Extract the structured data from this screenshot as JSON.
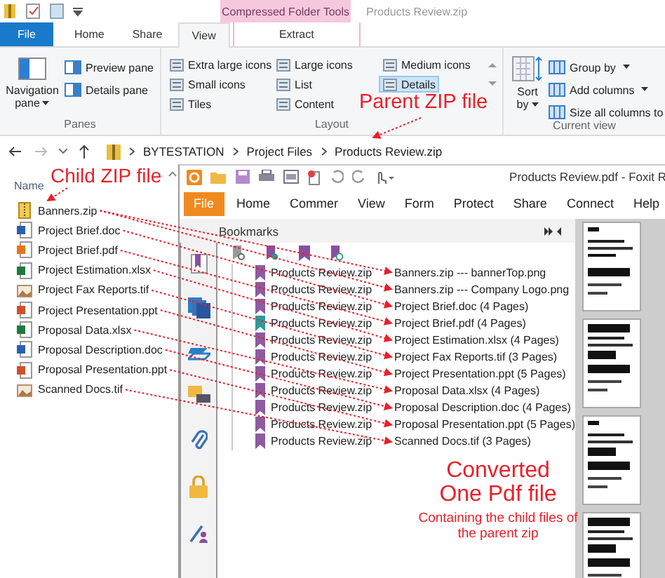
{
  "explorer": {
    "context_tab": "Compressed Folder Tools",
    "title": "Products Review.zip",
    "tabs": [
      {
        "label": "File",
        "kind": "file",
        "selected": false
      },
      {
        "label": "Home",
        "kind": "tab",
        "selected": false
      },
      {
        "label": "Share",
        "kind": "tab",
        "selected": false
      },
      {
        "label": "View",
        "kind": "tab",
        "selected": true
      },
      {
        "label": "Extract",
        "kind": "context",
        "selected": false
      }
    ],
    "ribbon": {
      "panes": {
        "label": "Panes",
        "navigation": {
          "label": "Navigation pane",
          "dropdown": true
        },
        "items": [
          "Preview pane",
          "Details pane"
        ]
      },
      "layout": {
        "label": "Layout",
        "options": [
          {
            "label": "Extra large icons",
            "selected": false
          },
          {
            "label": "Large icons",
            "selected": false
          },
          {
            "label": "Medium icons",
            "selected": false
          },
          {
            "label": "Small icons",
            "selected": false
          },
          {
            "label": "List",
            "selected": false
          },
          {
            "label": "Details",
            "selected": true
          },
          {
            "label": "Tiles",
            "selected": false
          },
          {
            "label": "Content",
            "selected": false
          }
        ]
      },
      "current_view": {
        "label": "Current view",
        "sort": {
          "label": "Sort by",
          "dropdown": true
        },
        "items": [
          {
            "label": "Group by",
            "dropdown": true
          },
          {
            "label": "Add columns",
            "dropdown": true
          },
          {
            "label": "Size all columns to",
            "dropdown": false
          }
        ]
      }
    },
    "address_bar": {
      "path": [
        "BYTESTATION",
        "Project Files",
        "Products Review.zip"
      ]
    },
    "file_list": {
      "header": "Name",
      "files": [
        {
          "name": "Banners.zip",
          "kind": "zip"
        },
        {
          "name": "Project Brief.doc",
          "kind": "doc"
        },
        {
          "name": "Project Brief.pdf",
          "kind": "pdf"
        },
        {
          "name": "Project Estimation.xlsx",
          "kind": "xlsx"
        },
        {
          "name": "Project Fax Reports.tif",
          "kind": "tif"
        },
        {
          "name": "Project Presentation.ppt",
          "kind": "ppt"
        },
        {
          "name": "Proposal Data.xlsx",
          "kind": "xlsx"
        },
        {
          "name": "Proposal Description.doc",
          "kind": "doc"
        },
        {
          "name": "Proposal Presentation.ppt",
          "kind": "ppt"
        },
        {
          "name": "Scanned Docs.tif",
          "kind": "tif"
        }
      ]
    }
  },
  "pdf_viewer": {
    "title": "Products Review.pdf - Foxit R",
    "menu": [
      {
        "label": "File",
        "selected": true
      },
      {
        "label": "Home",
        "selected": false
      },
      {
        "label": "Commer",
        "selected": false
      },
      {
        "label": "View",
        "selected": false
      },
      {
        "label": "Form",
        "selected": false
      },
      {
        "label": "Protect",
        "selected": false
      },
      {
        "label": "Share",
        "selected": false
      },
      {
        "label": "Connect",
        "selected": false
      },
      {
        "label": "Help",
        "selected": false
      }
    ],
    "panel_title": "Bookmarks",
    "bookmarks": [
      {
        "prefix": "Products Review.zip",
        "entry": "Banners.zip --- bannerTop.png",
        "color": "#8e5aa0"
      },
      {
        "prefix": "Products Review.zip",
        "entry": "Banners.zip --- Company Logo.png",
        "color": "#8e5aa0"
      },
      {
        "prefix": "Products Review.zip",
        "entry": "Project Brief.doc (4 Pages)",
        "color": "#8e5aa0"
      },
      {
        "prefix": "Products Review.zip",
        "entry": "Project Brief.pdf (4 Pages)",
        "color": "#2e9a9a"
      },
      {
        "prefix": "Products Review.zip",
        "entry": "Project Estimation.xlsx (4 Pages)",
        "color": "#8e5aa0"
      },
      {
        "prefix": "Products Review.zip",
        "entry": "Project Fax Reports.tif (3 Pages)",
        "color": "#8e5aa0"
      },
      {
        "prefix": "Products Review.zip",
        "entry": "Project Presentation.ppt (5 Pages)",
        "color": "#8e5aa0"
      },
      {
        "prefix": "Products Review.zip",
        "entry": "Proposal Data.xlsx (4 Pages)",
        "color": "#8e5aa0"
      },
      {
        "prefix": "Products Review.zip",
        "entry": "Proposal Description.doc (4 Pages)",
        "color": "#8e5aa0"
      },
      {
        "prefix": "Products Review.zip",
        "entry": "Proposal Presentation.ppt (5 Pages)",
        "color": "#8e5aa0"
      },
      {
        "prefix": "Products Review.zip",
        "entry": "Scanned Docs.tif (3 Pages)",
        "color": "#8e5aa0"
      }
    ]
  },
  "annotations": {
    "parent_zip": "Parent ZIP file",
    "child_zip": "Child ZIP file",
    "result_title": "Converted One Pdf file",
    "result_caption": "Containing the child files of the parent zip"
  }
}
